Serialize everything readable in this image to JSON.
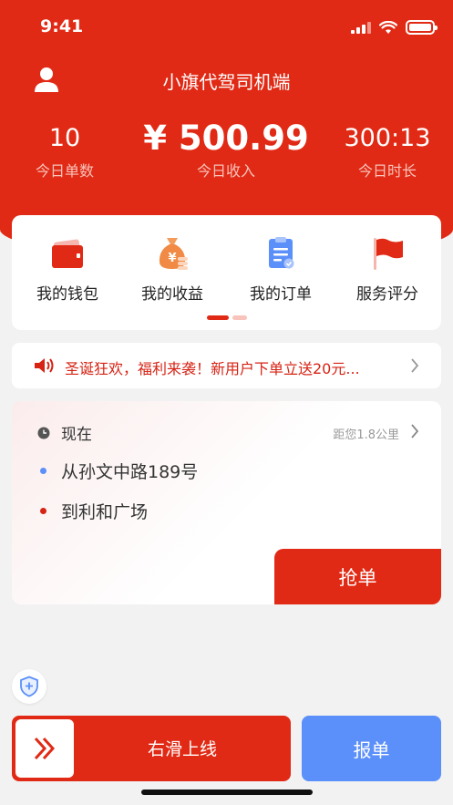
{
  "status_bar": {
    "time": "9:41"
  },
  "header": {
    "title": "小旗代驾司机端",
    "stats": [
      {
        "value": "10",
        "label": "今日单数"
      },
      {
        "value": "¥ 500.99",
        "label": "今日收入"
      },
      {
        "value": "300:13",
        "label": "今日时长"
      }
    ]
  },
  "menu": [
    {
      "label": "我的钱包",
      "icon": "wallet-icon"
    },
    {
      "label": "我的收益",
      "icon": "money-bag-icon"
    },
    {
      "label": "我的订单",
      "icon": "clipboard-icon"
    },
    {
      "label": "服务评分",
      "icon": "flag-icon"
    }
  ],
  "notice": {
    "text": "圣诞狂欢，福利来袭！新用户下单立送20元..."
  },
  "order": {
    "time": "现在",
    "distance": "距您1.8公里",
    "from": "从孙文中路189号",
    "to": "到利和广场",
    "grab_label": "抢单"
  },
  "footer": {
    "slide_label": "右滑上线",
    "report_label": "报单"
  },
  "colors": {
    "brand_red": "#e12a15",
    "report_blue": "#5b8ff9",
    "from_dot": "#5b8ff9",
    "to_dot": "#d62314"
  }
}
